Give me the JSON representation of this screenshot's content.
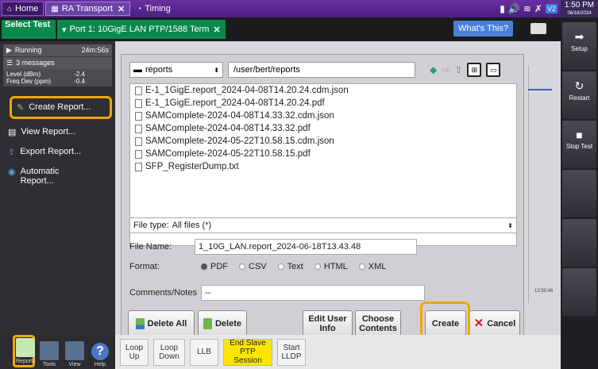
{
  "topbar": {
    "tabs": [
      {
        "label": "Home",
        "icon": "home-icon"
      },
      {
        "label": "RA Transport",
        "icon": "transport-icon"
      },
      {
        "label": "Timing",
        "icon": "timing-icon"
      }
    ],
    "status_badge": "V2",
    "time": "1:50 PM",
    "date": "06/18/2024"
  },
  "subbar": {
    "select_test": "Select Test",
    "port_tab": "Port 1: 10GigE LAN PTP/1588 Term",
    "whats_this": "What's This?"
  },
  "status": {
    "running": "Running",
    "elapsed": "24m:56s",
    "messages": "3 messages",
    "level_label": "Level (dBm)",
    "level_value": "-2.4",
    "freq_label": "Freq Dev (ppm)",
    "freq_value": "-0.4"
  },
  "menu": {
    "create_report": "Create Report...",
    "view_report": "View Report...",
    "export_report": "Export Report...",
    "automatic_report": "Automatic Report..."
  },
  "dialog": {
    "location": "reports",
    "path": "/user/bert/reports",
    "files": [
      "E-1_1GigE.report_2024-04-08T14.20.24.cdm.json",
      "E-1_1GigE.report_2024-04-08T14.20.24.pdf",
      "SAMComplete-2024-04-08T14.33.32.cdm.json",
      "SAMComplete-2024-04-08T14.33.32.pdf",
      "SAMComplete-2024-05-22T10.58.15.cdm.json",
      "SAMComplete-2024-05-22T10.58.15.pdf",
      "SFP_RegisterDump.txt"
    ],
    "file_type_label": "File type:",
    "file_type_value": "All files (*)",
    "file_name_label": "File Name:",
    "file_name_value": "1_10G_LAN.report_2024-06-18T13.43.48",
    "format_label": "Format:",
    "formats": [
      "PDF",
      "CSV",
      "Text",
      "HTML",
      "XML"
    ],
    "selected_format": "PDF",
    "comments_label": "Comments/Notes",
    "comments_value": "--",
    "delete_all": "Delete All",
    "delete": "Delete",
    "edit_user_info": "Edit User Info",
    "choose_contents": "Choose Contents",
    "create": "Create",
    "cancel": "Cancel"
  },
  "background": {
    "timestamp": "13:50:46"
  },
  "bottombar": {
    "icons": [
      "Reports",
      "Tools",
      "View",
      "Help"
    ],
    "buttons": [
      "Loop Up",
      "Loop Down",
      "LLB",
      "End Slave PTP Session",
      "Start LLDP"
    ]
  },
  "rightpanel": {
    "setup": "Setup",
    "restart": "Restart",
    "stop_test": "Stop Test"
  },
  "colors": {
    "accent_highlight": "#f0a800",
    "tab_bar": "#5a2890",
    "test_green": "#0a8a4a",
    "yellow_button": "#ffe400"
  }
}
